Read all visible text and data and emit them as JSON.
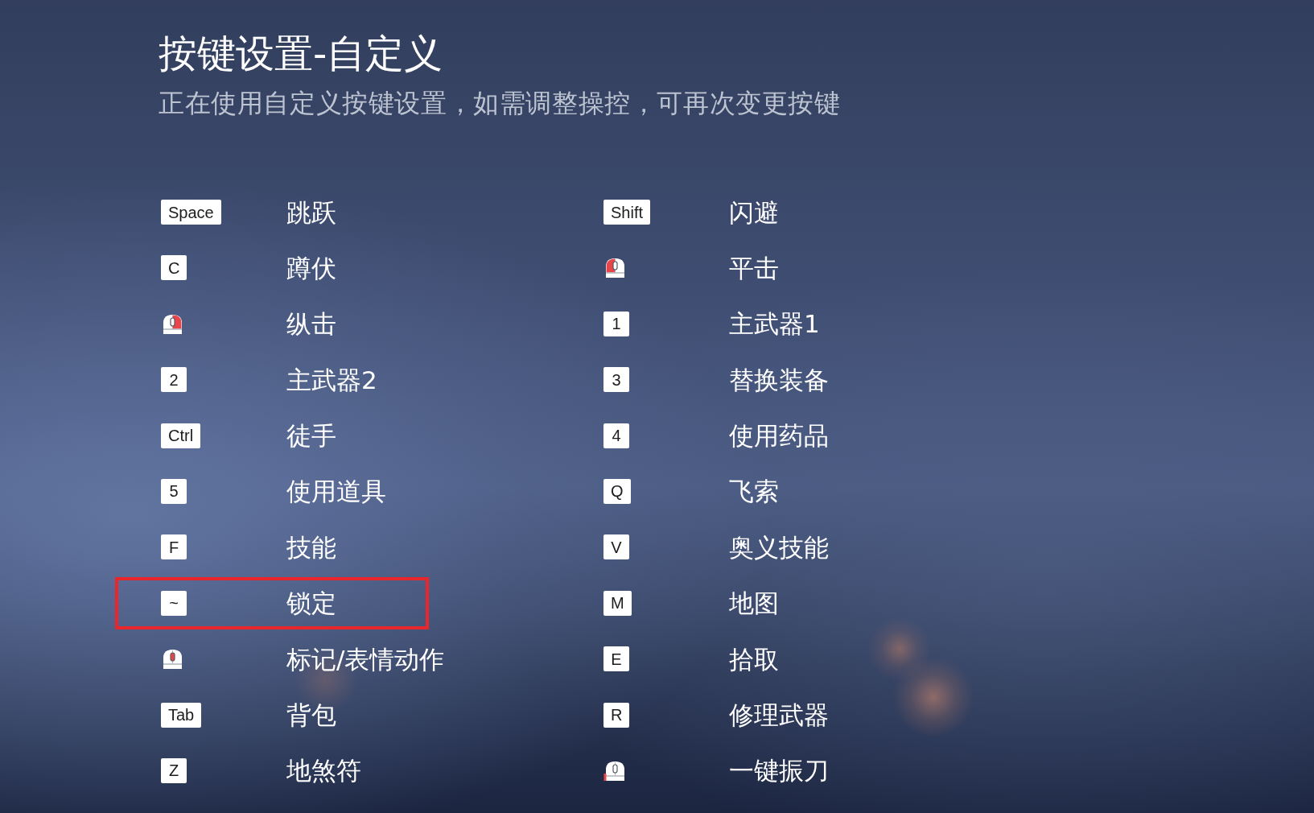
{
  "title": "按键设置-自定义",
  "subtitle": "正在使用自定义按键设置，如需调整操控，可再次变更按键",
  "columns": [
    {
      "bindings": [
        {
          "kind": "key",
          "key": "Space",
          "action": "跳跃",
          "highlighted": false
        },
        {
          "kind": "key",
          "key": "C",
          "action": "蹲伏",
          "highlighted": false
        },
        {
          "kind": "mouse_right",
          "action": "纵击",
          "highlighted": false
        },
        {
          "kind": "key",
          "key": "2",
          "action": "主武器2",
          "highlighted": false
        },
        {
          "kind": "key",
          "key": "Ctrl",
          "action": "徒手",
          "highlighted": false
        },
        {
          "kind": "key",
          "key": "5",
          "action": "使用道具",
          "highlighted": false
        },
        {
          "kind": "key",
          "key": "F",
          "action": "技能",
          "highlighted": false
        },
        {
          "kind": "key",
          "key": "~",
          "action": "锁定",
          "highlighted": true
        },
        {
          "kind": "mouse_middle",
          "action": "标记/表情动作",
          "highlighted": false
        },
        {
          "kind": "key",
          "key": "Tab",
          "action": "背包",
          "highlighted": false
        },
        {
          "kind": "key",
          "key": "Z",
          "action": "地煞符",
          "highlighted": false
        }
      ]
    },
    {
      "bindings": [
        {
          "kind": "key",
          "key": "Shift",
          "action": "闪避",
          "highlighted": false
        },
        {
          "kind": "mouse_left",
          "action": "平击",
          "highlighted": false
        },
        {
          "kind": "key",
          "key": "1",
          "action": "主武器1",
          "highlighted": false
        },
        {
          "kind": "key",
          "key": "3",
          "action": "替换装备",
          "highlighted": false
        },
        {
          "kind": "key",
          "key": "4",
          "action": "使用药品",
          "highlighted": false
        },
        {
          "kind": "key",
          "key": "Q",
          "action": "飞索",
          "highlighted": false
        },
        {
          "kind": "key",
          "key": "V",
          "action": "奥义技能",
          "highlighted": false
        },
        {
          "kind": "key",
          "key": "M",
          "action": "地图",
          "highlighted": false
        },
        {
          "kind": "key",
          "key": "E",
          "action": "拾取",
          "highlighted": false
        },
        {
          "kind": "key",
          "key": "R",
          "action": "修理武器",
          "highlighted": false
        },
        {
          "kind": "mouse_side",
          "action": "一键振刀",
          "highlighted": false
        }
      ]
    }
  ]
}
